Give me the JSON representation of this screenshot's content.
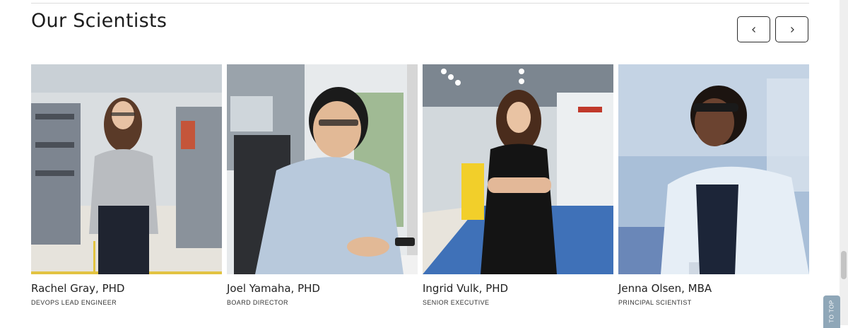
{
  "section": {
    "title": "Our Scientists"
  },
  "carousel": {
    "prev_icon": "chevron-left-icon",
    "next_icon": "chevron-right-icon"
  },
  "scientists": [
    {
      "name": "Rachel Gray, PHD",
      "role": "DEVOPS LEAD ENGINEER"
    },
    {
      "name": "Joel Yamaha, PHD",
      "role": "BOARD DIRECTOR"
    },
    {
      "name": "Ingrid Vulk, PHD",
      "role": "SENIOR EXECUTIVE"
    },
    {
      "name": "Jenna Olsen, MBA",
      "role": "PRINCIPAL SCIENTIST"
    }
  ],
  "to_top": {
    "label": "TO TOP"
  }
}
